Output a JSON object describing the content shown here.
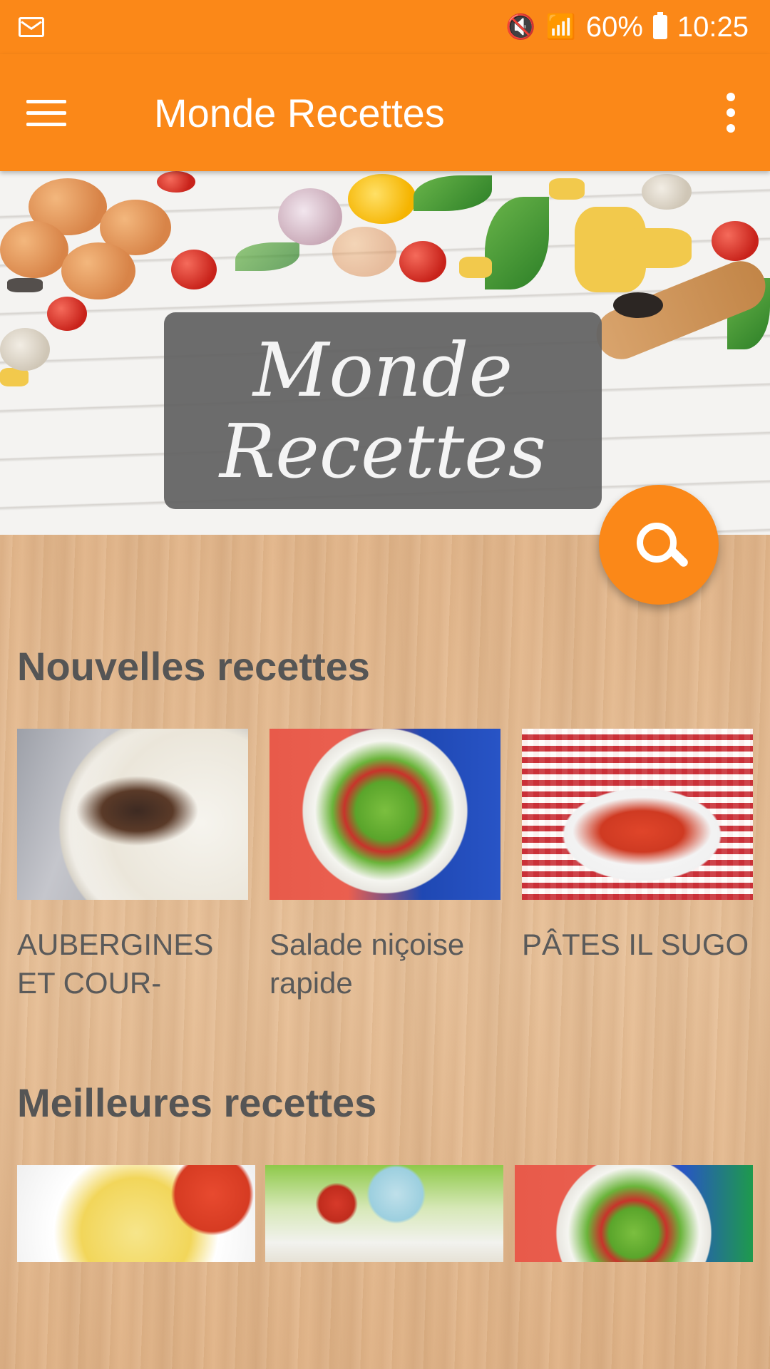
{
  "status_bar": {
    "battery": "60%",
    "time": "10:25",
    "icons": [
      "gmail-icon",
      "vibrate-mute-icon",
      "wifi-icon",
      "signal-icon",
      "battery-icon"
    ]
  },
  "toolbar": {
    "title": "Monde Recettes",
    "menu_icon": "hamburger-menu-icon",
    "overflow_icon": "more-vert-icon"
  },
  "banner": {
    "logo_line1": "Monde",
    "logo_line2": "Recettes"
  },
  "fab": {
    "icon": "search-icon"
  },
  "sections": {
    "new": {
      "title": "Nouvelles recettes",
      "items": [
        {
          "label": "AUBERGINES ET COUR-"
        },
        {
          "label": "Salade niçoise rapide"
        },
        {
          "label": "PÂTES IL SUGO"
        }
      ]
    },
    "best": {
      "title": "Meilleures recettes"
    }
  },
  "colors": {
    "primary": "#fb8818",
    "text": "#555555"
  }
}
